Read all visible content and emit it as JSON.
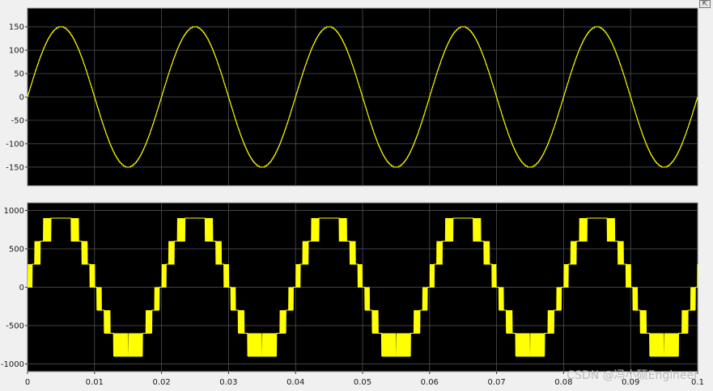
{
  "toolbar": {
    "restore_icon": "restore-axes-icon"
  },
  "watermark": "CSDN @冯小硕Engineer",
  "colors": {
    "figure_bg": "#f0f0f0",
    "axes_bg": "#000000",
    "grid": "#5a5a5a",
    "trace": "#ffff00",
    "axes_border": "#a0a0a0"
  },
  "chart_data": [
    {
      "type": "line",
      "title": "",
      "xlabel": "",
      "ylabel": "",
      "grid": true,
      "xlim": [
        0,
        0.1
      ],
      "ylim": [
        -190,
        190
      ],
      "yticks": [
        150,
        100,
        50,
        0,
        -50,
        -100,
        -150
      ],
      "ytick_labels": [
        "150",
        "100",
        "50",
        "0",
        "-50",
        "-100",
        "-150"
      ],
      "series": [
        {
          "color": "#ffff00",
          "waveform": "sine",
          "amplitude": 150,
          "frequency_hz": 50,
          "x": [
            0,
            0.005,
            0.01,
            0.015,
            0.02,
            0.025,
            0.03,
            0.035,
            0.04,
            0.045,
            0.05,
            0.055,
            0.06,
            0.065,
            0.07,
            0.075,
            0.08,
            0.085,
            0.09,
            0.095,
            0.1
          ],
          "y": [
            0,
            150,
            0,
            -150,
            0,
            150,
            0,
            -150,
            0,
            150,
            0,
            -150,
            0,
            150,
            0,
            -150,
            0,
            150,
            0,
            -150,
            0
          ]
        }
      ]
    },
    {
      "type": "line",
      "title": "",
      "xlabel": "",
      "ylabel": "",
      "grid": true,
      "xlim": [
        0,
        0.1
      ],
      "ylim": [
        -1100,
        1100
      ],
      "yticks": [
        1000,
        500,
        0,
        -500,
        -1000
      ],
      "ytick_labels": [
        "1000",
        "500",
        "0",
        "-500",
        "-1000"
      ],
      "xticks": [
        0,
        0.01,
        0.02,
        0.03,
        0.04,
        0.05,
        0.06,
        0.07,
        0.08,
        0.09,
        0.1
      ],
      "xtick_labels": [
        "0",
        "0.01",
        "0.02",
        "0.03",
        "0.04",
        "0.05",
        "0.06",
        "0.07",
        "0.08",
        "0.09",
        "0.1"
      ],
      "series": [
        {
          "color": "#ffff00",
          "waveform": "seven-level multilevel staircase (PWM at 900 V level)",
          "levels": [
            -900,
            -600,
            -300,
            0,
            300,
            600,
            900
          ],
          "frequency_hz": 50,
          "x": [
            0,
            0.005,
            0.01,
            0.015,
            0.02
          ],
          "y": [
            0,
            900,
            0,
            -900,
            0
          ]
        }
      ]
    }
  ]
}
